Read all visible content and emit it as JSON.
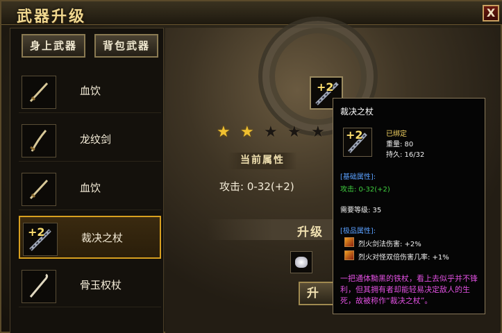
{
  "window": {
    "title": "武器升级",
    "close_label": "X"
  },
  "tabs": [
    {
      "label": "身上武器"
    },
    {
      "label": "背包武器"
    }
  ],
  "weapons": [
    {
      "name": "血饮",
      "plus": ""
    },
    {
      "name": "龙纹剑",
      "plus": ""
    },
    {
      "name": "血饮",
      "plus": ""
    },
    {
      "name": "裁决之杖",
      "plus": "+2",
      "selected": true
    },
    {
      "name": "骨玉权杖",
      "plus": ""
    }
  ],
  "upgrade": {
    "slot_plus": "+2",
    "stars_total": 5,
    "stars_filled": 2,
    "current_attr_title": "当前属性",
    "attack_text": "攻击: 0-32(+2)",
    "upgrade_label": "升级",
    "upgrade_button": "升"
  },
  "tooltip": {
    "title": "裁决之杖",
    "plus": "+2",
    "bound": "已绑定",
    "weight": "重量: 80",
    "durability": "持久: 16/32",
    "base_header": "[基础属性]:",
    "base_attack": "攻击: 0-32(+2)",
    "req_level": "需要等级: 35",
    "extra_header": "[极品属性]:",
    "bonus1": "烈火剑法伤害: +2%",
    "bonus2": "烈火对怪双倍伤害几率: +1%",
    "description": "一把通体黝黑的铁杖，看上去似乎并不锋利，但其拥有者却能轻易决定敌人的生死，故被称作“裁决之杖”。"
  },
  "colors": {
    "accent_gold": "#d8a020",
    "title_gold": "#f0d890",
    "magic_blue": "#5aa0ff",
    "green_stat": "#40d040",
    "desc_magenta": "#e050e0"
  }
}
